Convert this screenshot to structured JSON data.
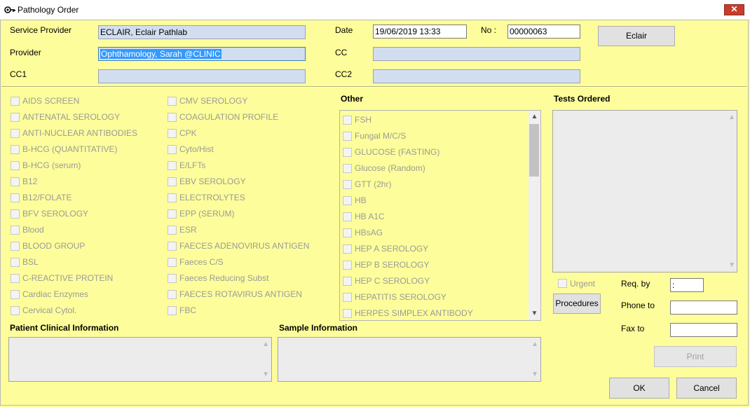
{
  "window": {
    "title": "Pathology Order",
    "close_label": "✕"
  },
  "header": {
    "service_provider_label": "Service Provider",
    "service_provider_value": "ECLAIR, Eclair Pathlab",
    "provider_label": "Provider",
    "provider_value": "Ophthamology, Sarah @CLINIC",
    "cc1_label": "CC1",
    "cc1_value": "",
    "date_label": "Date",
    "date_value": "19/06/2019 13:33",
    "no_label": "No :",
    "no_value": "00000063",
    "cc_label": "CC",
    "cc_value": "",
    "cc2_label": "CC2",
    "cc2_value": "",
    "eclair_button": "Eclair"
  },
  "tests_col1": [
    "AIDS SCREEN",
    "ANTENATAL SEROLOGY",
    "ANTI-NUCLEAR ANTIBODIES",
    "B-HCG (QUANTITATIVE)",
    "B-HCG (serum)",
    "B12",
    "B12/FOLATE",
    "BFV SEROLOGY",
    "Blood",
    "BLOOD GROUP",
    "BSL",
    "C-REACTIVE PROTEIN",
    "Cardiac Enzymes",
    "Cervical Cytol."
  ],
  "tests_col2": [
    "CMV SEROLOGY",
    "COAGULATION PROFILE",
    "CPK",
    "Cyto/Hist",
    "E/LFTs",
    "EBV SEROLOGY",
    "ELECTROLYTES",
    "EPP (SERUM)",
    "ESR",
    "FAECES ADENOVIRUS ANTIGEN",
    "Faeces C/S",
    "Faeces Reducing Subst",
    "FAECES ROTAVIRUS ANTIGEN",
    "FBC"
  ],
  "other": {
    "label": "Other",
    "items": [
      "FSH",
      "Fungal M/C/S",
      "GLUCOSE (FASTING)",
      "Glucose (Random)",
      "GTT (2hr)",
      "HB",
      "HB A1C",
      "HBsAG",
      "HEP A SEROLOGY",
      "HEP B SEROLOGY",
      "HEP C SEROLOGY",
      "HEPATITIS SEROLOGY",
      "HERPES SIMPLEX ANTIBODY"
    ]
  },
  "tests_ordered": {
    "label": "Tests Ordered"
  },
  "urgent_label": "Urgent",
  "procedures_button": "Procedures",
  "req_by_label": "Req. by",
  "req_by_value": ":",
  "phone_to_label": "Phone to",
  "phone_to_value": "",
  "fax_to_label": "Fax to",
  "fax_to_value": "",
  "print_button": "Print",
  "ok_button": "OK",
  "cancel_button": "Cancel",
  "patient_clinical_label": "Patient Clinical Information",
  "sample_info_label": "Sample Information"
}
